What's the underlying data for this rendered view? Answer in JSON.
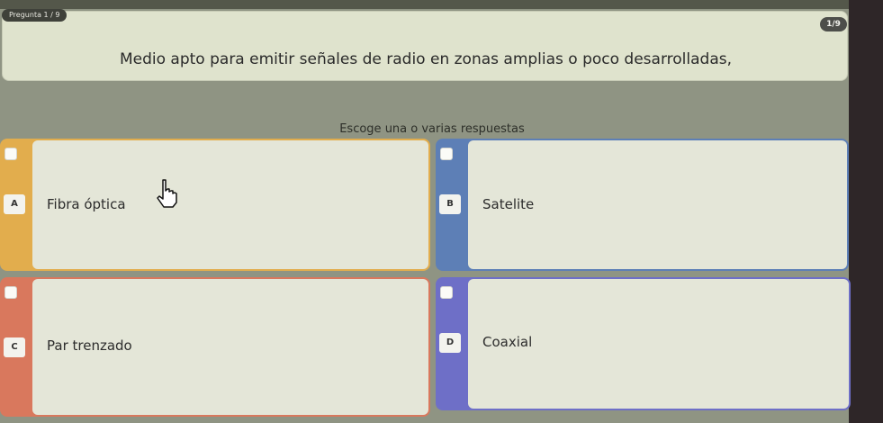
{
  "header": {
    "counter": "Pregunta 1 / 9",
    "page_badge": "1/9"
  },
  "question": {
    "text": "Medio apto para emitir señales de radio en zonas amplias o poco desarrolladas,"
  },
  "instruction": "Escoge una o varias respuestas",
  "options": [
    {
      "letter": "A",
      "label": "Fibra óptica",
      "color": "#e2ad4d"
    },
    {
      "letter": "B",
      "label": "Satelite",
      "color": "#5d7fb6"
    },
    {
      "letter": "C",
      "label": "Par trenzado",
      "color": "#d9785d"
    },
    {
      "letter": "D",
      "label": "Coaxial",
      "color": "#6e6fc7"
    }
  ],
  "icons": {
    "cursor": "hand-pointer-icon",
    "checkbox": "checkbox-icon"
  }
}
